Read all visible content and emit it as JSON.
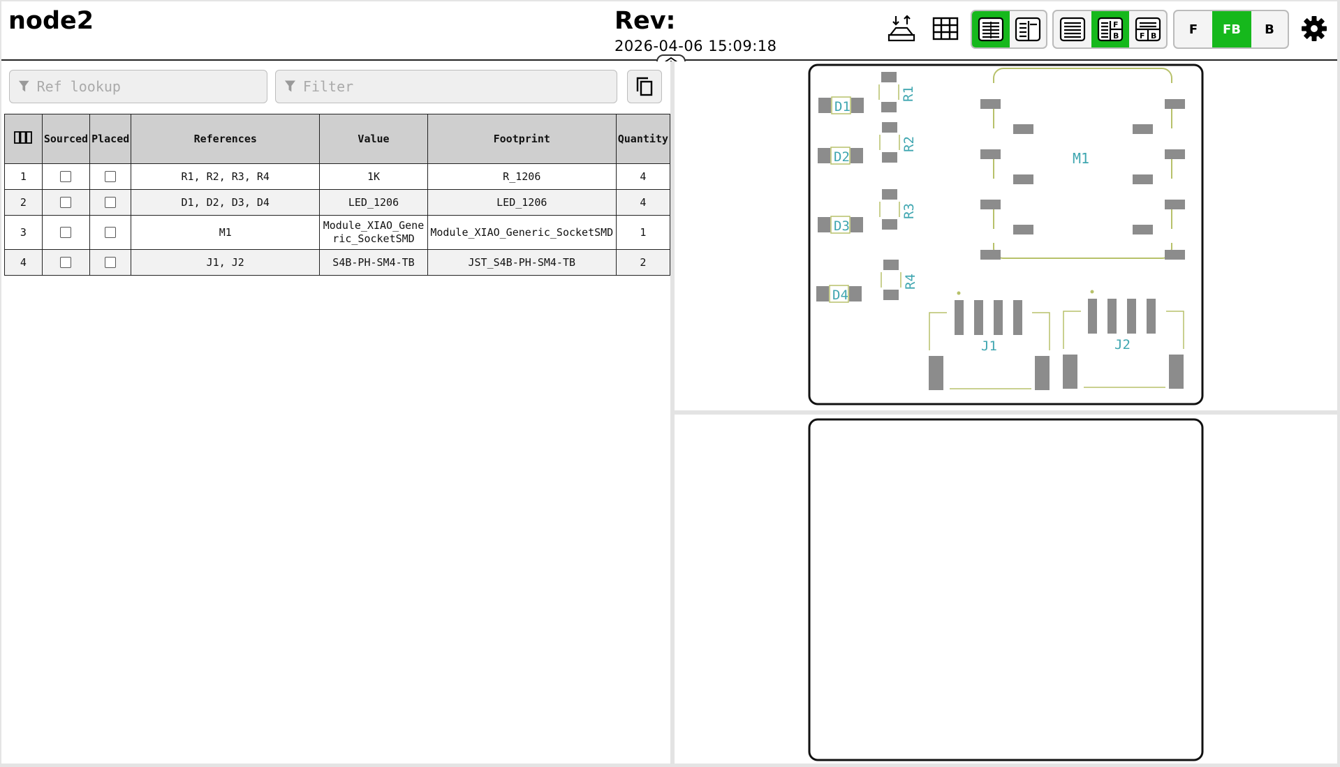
{
  "header": {
    "title": "node2",
    "rev_label": "Rev:",
    "date": "2026-04-06 15:09:18"
  },
  "toolbar": {
    "icons": [
      "dark-mode-toggle-icon",
      "grid-icon",
      "bom-only-icon",
      "bom-left-icon",
      "bom-top-icon",
      "bom-left-fb-icon",
      "bom-top-fb-icon"
    ],
    "layer_buttons": {
      "front": "F",
      "front_back": "FB",
      "back": "B"
    },
    "active_layer": "FB",
    "accent_color": "#16b81c"
  },
  "filters": {
    "ref_placeholder": "Ref lookup",
    "filter_placeholder": "Filter"
  },
  "table": {
    "headers": {
      "sourced": "Sourced",
      "placed": "Placed",
      "references": "References",
      "value": "Value",
      "footprint": "Footprint",
      "quantity": "Quantity"
    },
    "rows": [
      {
        "num": "1",
        "refs": "R1, R2, R3, R4",
        "value": "1K",
        "footprint": "R_1206",
        "qty": "4"
      },
      {
        "num": "2",
        "refs": "D1, D2, D3, D4",
        "value": "LED_1206",
        "footprint": "LED_1206",
        "qty": "4"
      },
      {
        "num": "3",
        "refs": "M1",
        "value": "Module_XIAO_Generic_SocketSMD",
        "footprint": "Module_XIAO_Generic_SocketSMD",
        "qty": "1"
      },
      {
        "num": "4",
        "refs": "J1, J2",
        "value": "S4B-PH-SM4-TB",
        "footprint": "JST_S4B-PH-SM4-TB",
        "qty": "2"
      }
    ]
  },
  "pcb": {
    "labels": {
      "d1": "D1",
      "d2": "D2",
      "d3": "D3",
      "d4": "D4",
      "r1": "R1",
      "r2": "R2",
      "r3": "R3",
      "r4": "R4",
      "m1": "M1",
      "j1": "J1",
      "j2": "J2"
    },
    "silkscreen_color": "#b7c16a",
    "label_color": "#3fa6b0",
    "pad_color": "#8c8c8c"
  }
}
